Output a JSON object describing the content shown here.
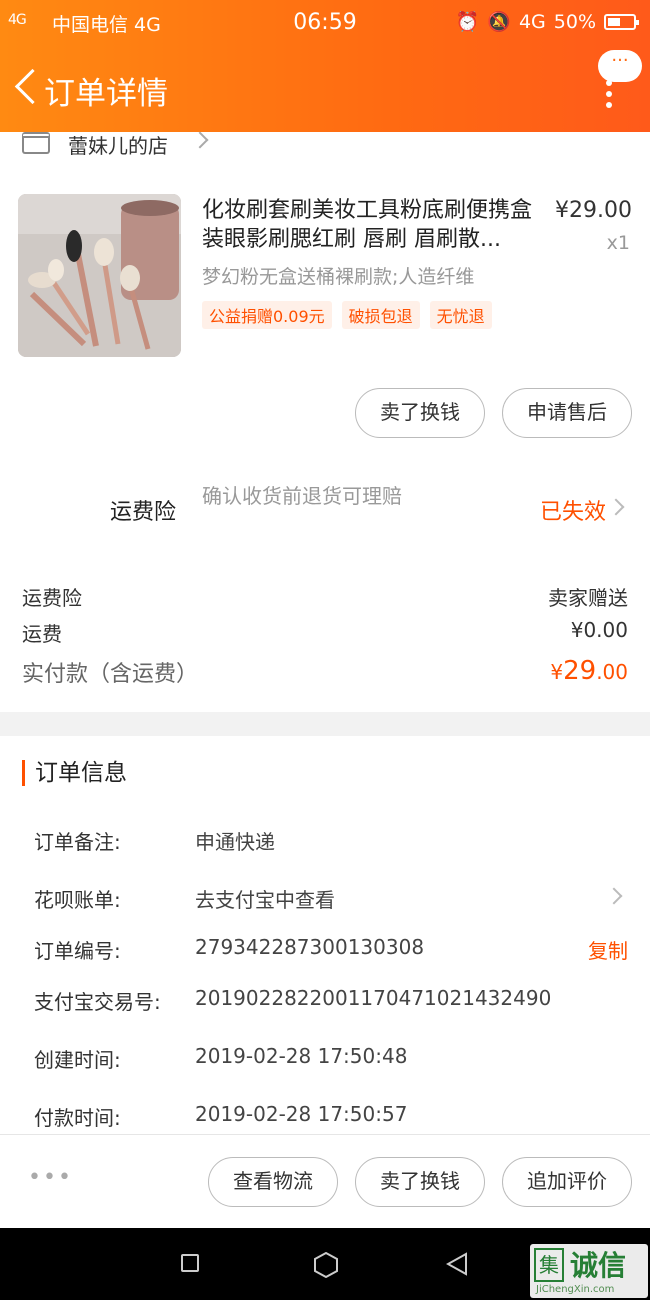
{
  "status_bar": {
    "signal": "4G",
    "carrier": "中国电信 4G",
    "time": "06:59",
    "network": "4G",
    "battery": "50%"
  },
  "nav": {
    "title": "订单详情",
    "more_label": "···"
  },
  "shop": {
    "name": "蕾妹儿的店"
  },
  "product": {
    "title": "化妆刷套刷美妆工具粉底刷便携盒装眼影刷腮红刷 唇刷 眉刷散...",
    "price": "¥29.00",
    "quantity": "x1",
    "sku": "梦幻粉无盒送桶裸刷款;人造纤维",
    "tags": [
      "公益捐赠0.09元",
      "破损包退",
      "无忧退"
    ]
  },
  "item_actions": {
    "sell_label": "卖了换钱",
    "after_sale_label": "申请售后"
  },
  "freight_insurance": {
    "label": "运费险",
    "description": "确认收货前退货可理赔",
    "status": "已失效"
  },
  "summary": {
    "insurance_label": "运费险",
    "insurance_value": "卖家赠送",
    "shipping_label": "运费",
    "shipping_value": "¥0.00",
    "total_label": "实付款（含运费）",
    "total_currency": "¥",
    "total_int": "29",
    "total_dec": ".00"
  },
  "order_info": {
    "title": "订单信息",
    "rows": [
      {
        "label": "订单备注:",
        "value": "申通快递"
      },
      {
        "label": "花呗账单:",
        "value": "去支付宝中查看"
      },
      {
        "label": "订单编号:",
        "value": "279342287300130308",
        "action": "复制"
      },
      {
        "label": "支付宝交易号:",
        "value": "2019022822001170471021432490"
      },
      {
        "label": "创建时间:",
        "value": "2019-02-28 17:50:48"
      },
      {
        "label": "付款时间:",
        "value": "2019-02-28 17:50:57"
      }
    ]
  },
  "bottom_bar": {
    "more": "•••",
    "logistics_label": "查看物流",
    "sell_label": "卖了换钱",
    "review_label": "追加评价"
  },
  "watermark": {
    "box": "集",
    "text": "诚信",
    "url": "JiChengXin.com"
  },
  "colors": {
    "accent": "#ff5000",
    "header_start": "#ff8a12",
    "header_end": "#ff5a1a"
  }
}
